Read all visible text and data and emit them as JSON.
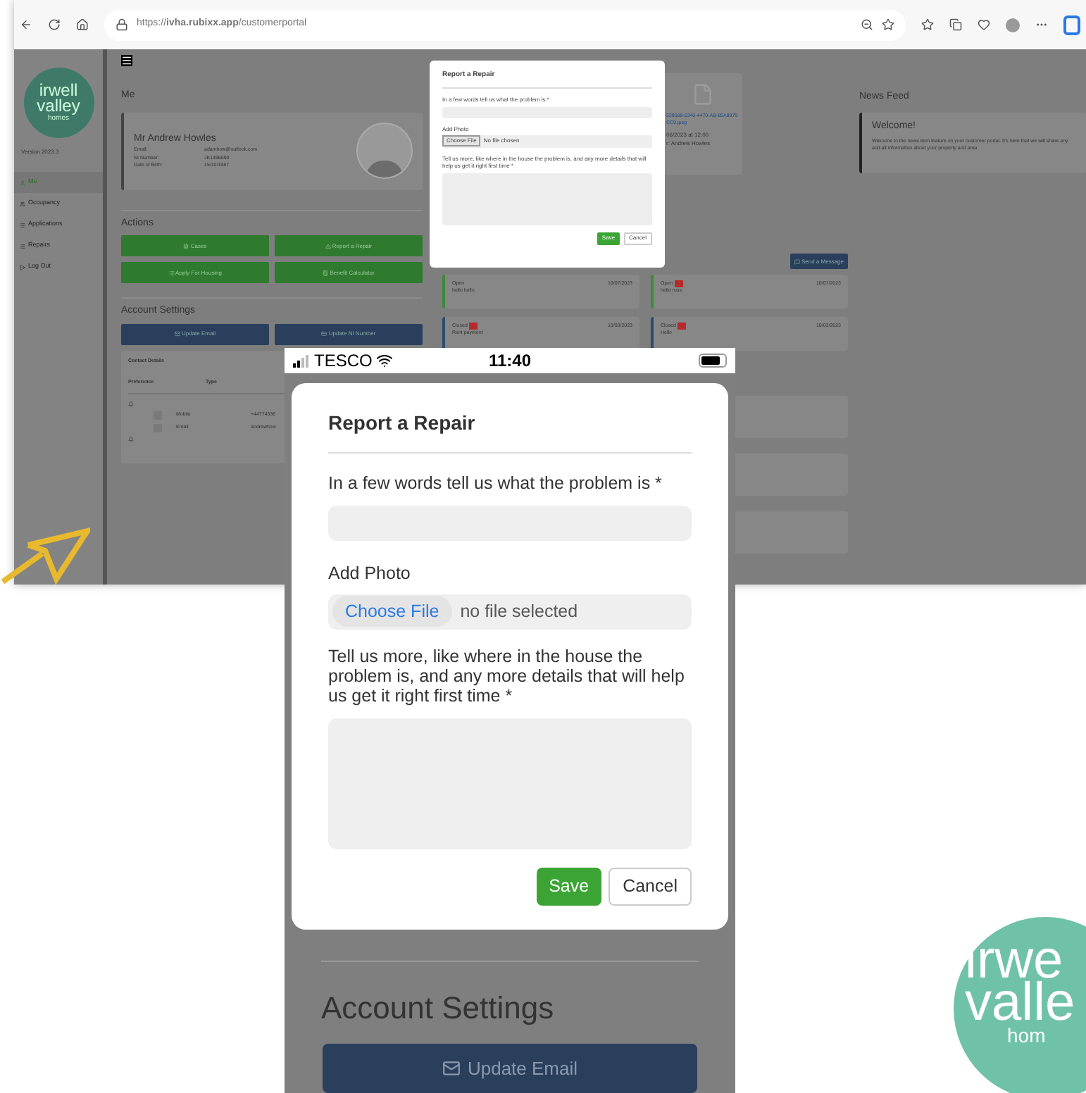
{
  "browser": {
    "url": "https://**ivha.rubixx.app**/customerportal"
  },
  "sidebar": {
    "logo": [
      "irwell",
      "valley",
      "homes"
    ],
    "version": "Version 2023.3",
    "items": [
      {
        "label": "Me",
        "selected": true
      },
      {
        "label": "Occupancy",
        "selected": false
      },
      {
        "label": "Applications",
        "selected": false
      },
      {
        "label": "Repairs",
        "selected": false
      },
      {
        "label": "Log Out",
        "selected": false
      }
    ]
  },
  "profile": {
    "heading": "Me",
    "name": "Mr Andrew Howles",
    "fields": [
      {
        "label": "Email:",
        "value": "adamhow@outlook.com"
      },
      {
        "label": "NI Number:",
        "value": "JK1496690"
      },
      {
        "label": "Date of Birth:",
        "value": "15/10/1987"
      }
    ]
  },
  "actions": {
    "heading": "Actions",
    "buttons": [
      "Cases",
      "Report a Repair",
      "Apply For Housing",
      "Benefit Calculator"
    ]
  },
  "account_settings": {
    "heading": "Account Settings",
    "buttons": [
      "Update Email",
      "Update NI Number"
    ]
  },
  "contact_details": {
    "title": "Contact Details",
    "columns": [
      "Preference",
      "Type"
    ],
    "rows": [
      {
        "type": "Mobile",
        "value": "+44774336"
      },
      {
        "type": "Email",
        "value": "andrewhow"
      }
    ]
  },
  "document": {
    "file": "529588-5340-4470-AB-85A8979CC9.jpeg",
    "date": "06/2023 at 12:00",
    "author": "r: Andrew Howles"
  },
  "messages": {
    "button": "Send a Message",
    "items": [
      {
        "status": "Open",
        "flagged": false,
        "text": "hello hello",
        "date": "10/07/2023",
        "color": "#3c8a3c"
      },
      {
        "status": "Open",
        "flagged": true,
        "text": "hello russ",
        "date": "10/07/2023",
        "color": "#3c8a3c"
      },
      {
        "status": "Closed",
        "flagged": true,
        "text": "Rent payment",
        "date": "10/03/2023",
        "color": "#2d4a6e"
      },
      {
        "status": "Closed",
        "flagged": true,
        "text": "Hello",
        "date": "10/03/2023",
        "color": "#2d4a6e"
      }
    ]
  },
  "news_feed": {
    "heading": "News Feed",
    "items": [
      {
        "title": "Welcome!",
        "text": "Welcome to the news item feature on your customer portal. It's here that we will share any and all information about your property and area"
      }
    ]
  },
  "desktop_modal": {
    "title": "Report a Repair",
    "problem_label": "In a few words tell us what the problem is *",
    "photo_label": "Add Photo",
    "file_button": "Choose File",
    "file_status": "No file chosen",
    "details_label": "Tell us more, like where in the house the problem is, and any more details that will help us get it right first time *",
    "save": "Save",
    "cancel": "Cancel"
  },
  "phone": {
    "carrier": "TESCO",
    "time": "11:40",
    "modal": {
      "title": "Report a Repair",
      "problem_label": "In a few words tell us what the problem is *",
      "photo_label": "Add Photo",
      "file_button": "Choose File",
      "file_status": "no file selected",
      "details_label": "Tell us more, like where in the house the problem is, and any more details that will help us get it right first time *",
      "save": "Save",
      "cancel": "Cancel"
    },
    "account_settings": {
      "heading": "Account Settings",
      "button": "Update Email"
    }
  },
  "corner_logo": [
    "irwe",
    "valle",
    "hom"
  ]
}
